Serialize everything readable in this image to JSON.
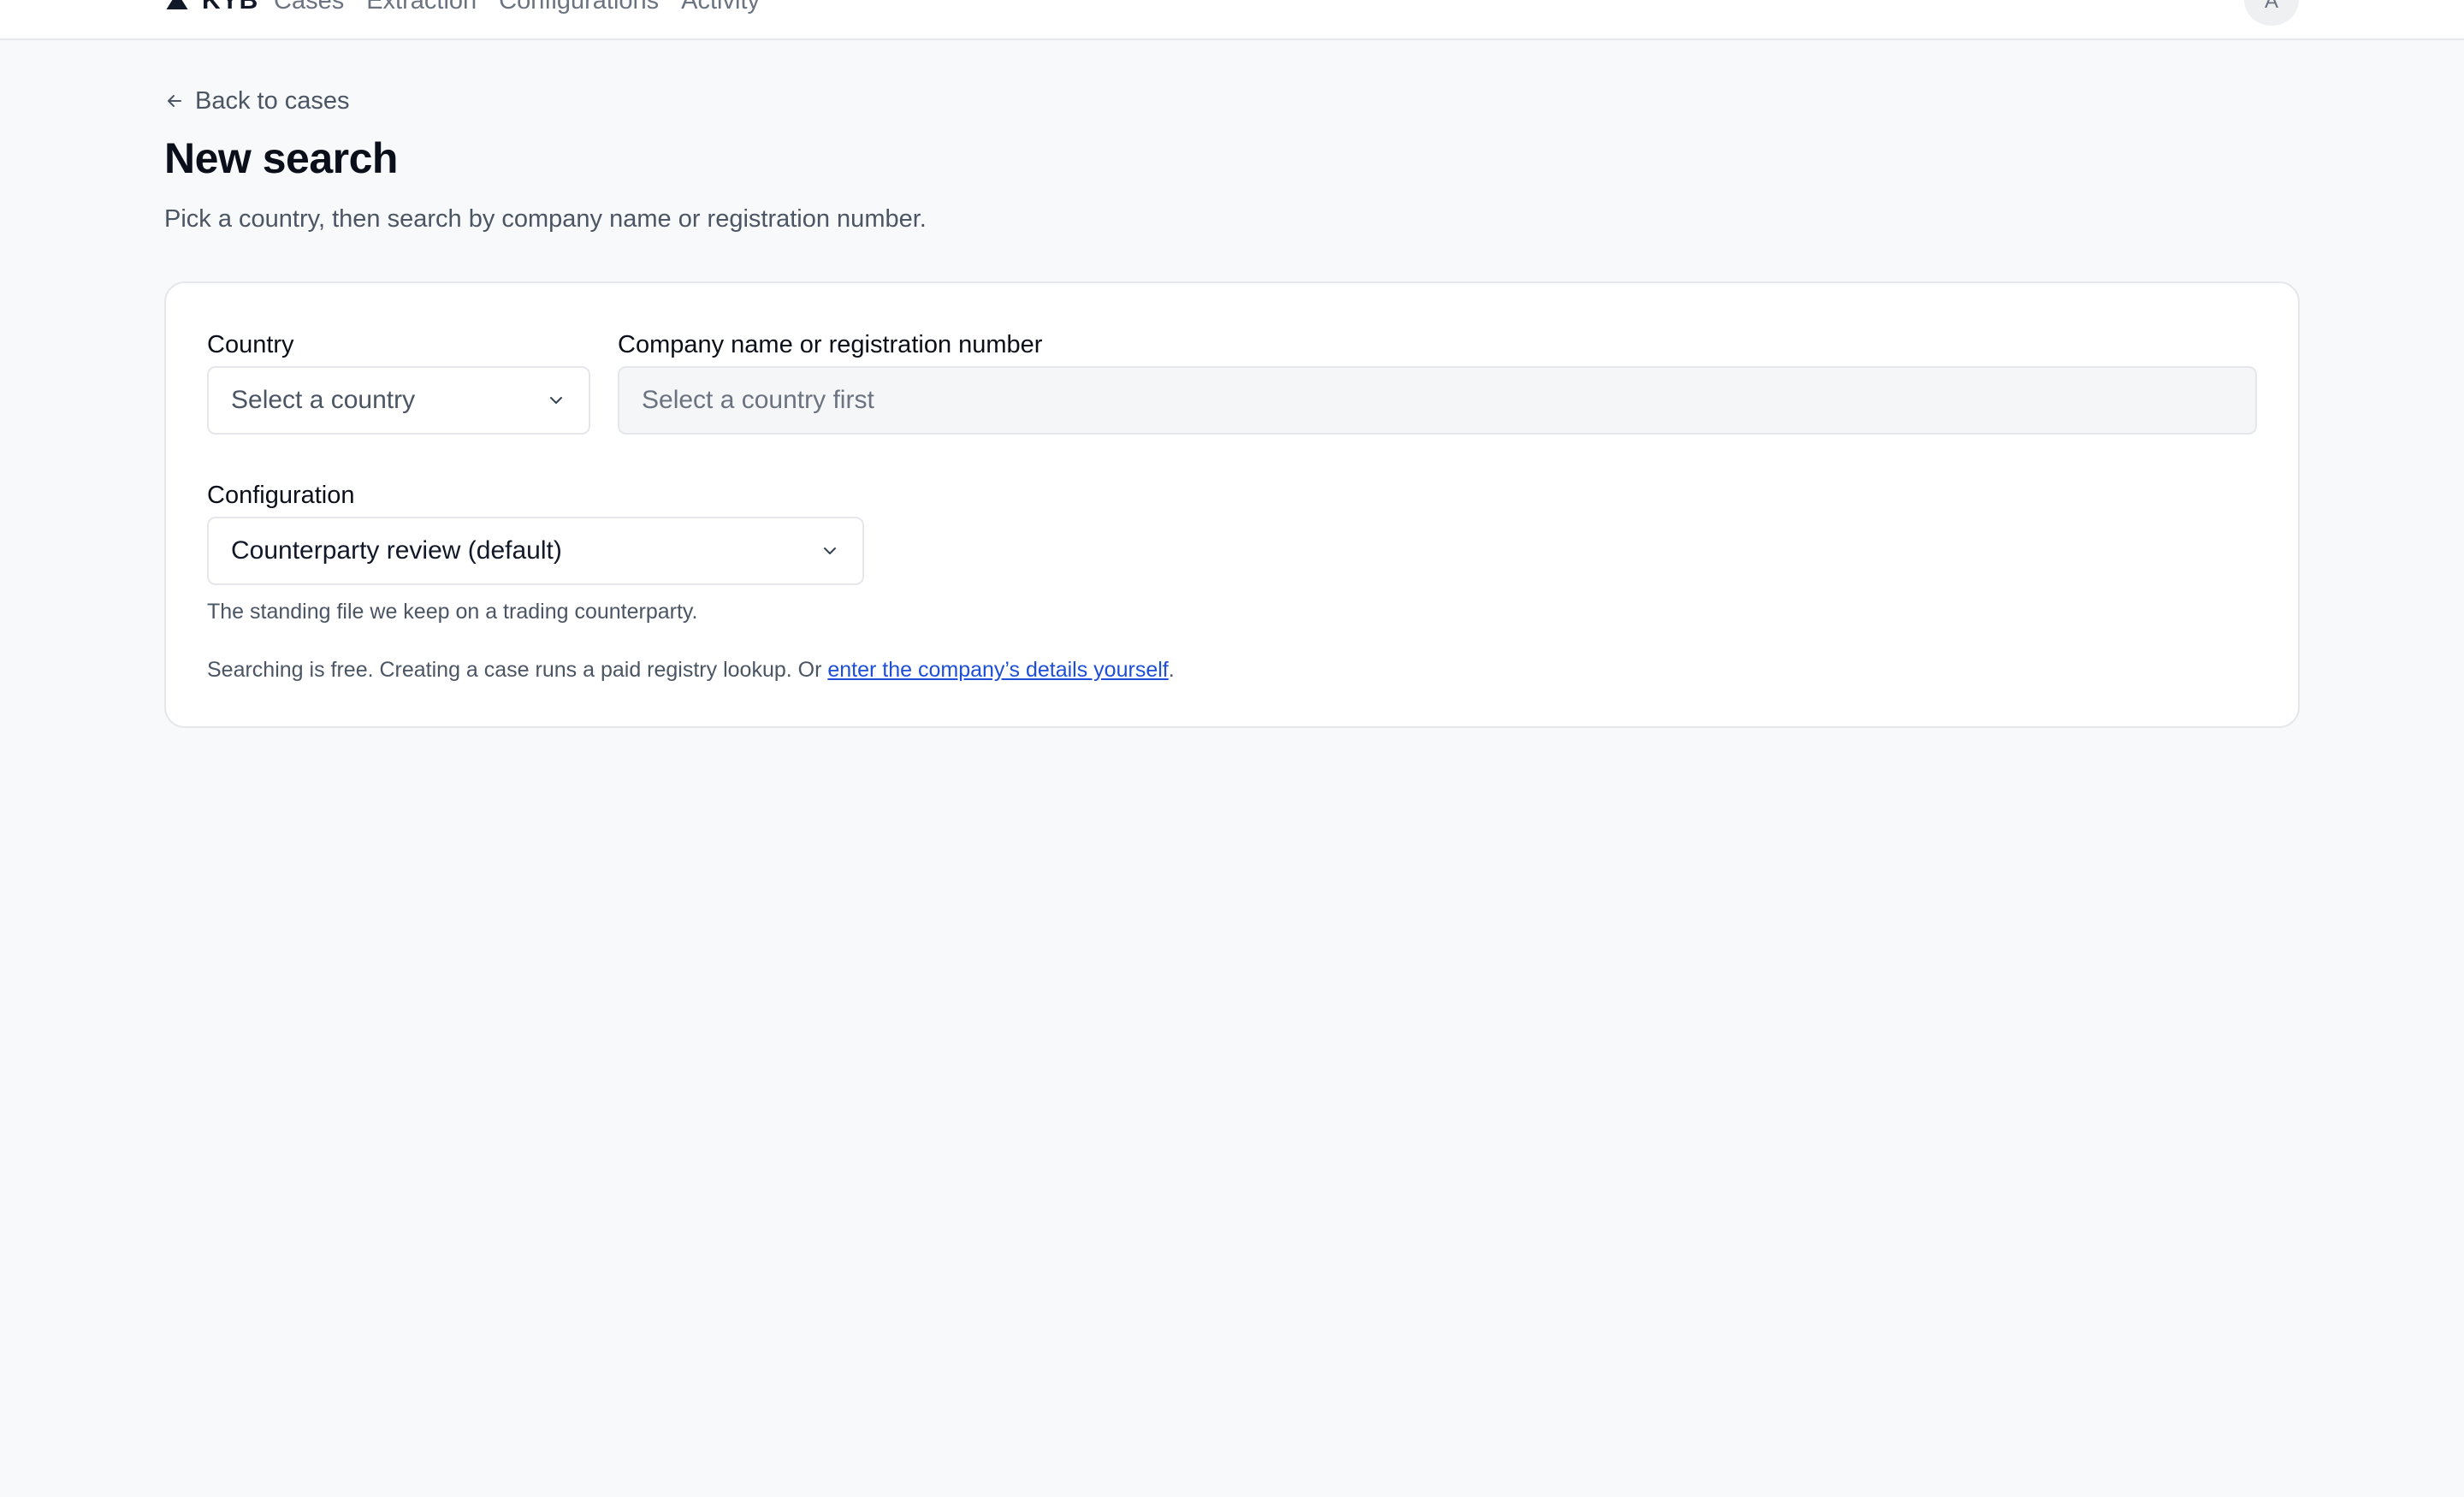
{
  "header": {
    "brand": "KYB",
    "nav": [
      "Cases",
      "Extraction",
      "Configurations",
      "Activity"
    ],
    "avatar_initial": "A"
  },
  "back_link": "Back to cases",
  "page": {
    "title": "New search",
    "subtitle": "Pick a country, then search by company name or registration number."
  },
  "form": {
    "country": {
      "label": "Country",
      "value": "Select a country"
    },
    "company": {
      "label": "Company name or registration number",
      "placeholder": "Select a country first"
    },
    "configuration": {
      "label": "Configuration",
      "value": "Counterparty review (default)",
      "help": "The standing file we keep on a trading counterparty."
    },
    "footer_text": "Searching is free. Creating a case runs a paid registry lookup. Or ",
    "footer_link": "enter the company’s details yourself",
    "footer_end": "."
  },
  "colors": {
    "background": "#f8f9fa",
    "card": "#ffffff",
    "border": "#e5e7eb",
    "link": "#1d4ed8",
    "muted_text": "#4b5563"
  },
  "icons": [
    "logo-icon",
    "arrow-left-icon",
    "chevron-down-icon"
  ]
}
